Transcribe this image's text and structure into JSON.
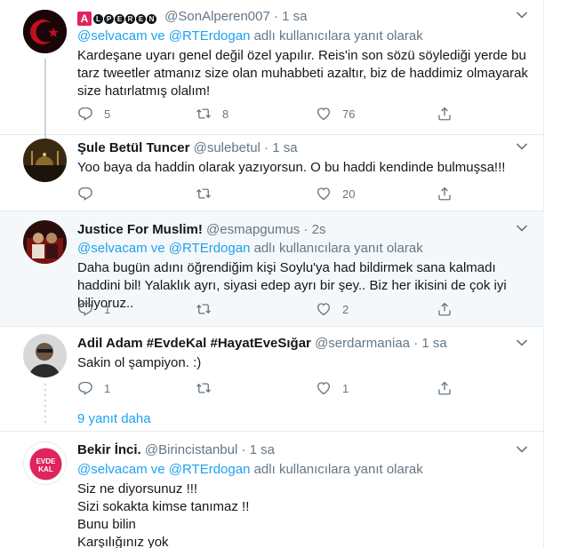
{
  "tweets": [
    {
      "name_badge": "A",
      "name_letters": [
        "L",
        "P",
        "E",
        "R",
        "E",
        "N"
      ],
      "handle": "@SonAlperen007",
      "dot": "·",
      "time": "1 sa",
      "reply_prefix": "@selvacam ve @RTErdogan",
      "reply_suffix": "adlı kullanıcılara yanıt olarak",
      "text": "Kardeşane uyarı genel değil özel yapılır. Reis'in son sözü söylediği yerde bu tarz tweetler atmanız size olan muhabbeti azaltır, biz de haddimiz olmayarak size hatırlatmış olalım!",
      "replies": "5",
      "retweets": "8",
      "likes": "76"
    },
    {
      "name": "Şule Betül Tuncer",
      "handle": "@sulebetul",
      "dot": "·",
      "time": "1 sa",
      "text": "Yoo baya da haddin olarak yazıyorsun. O bu haddi kendinde bulmuşsa!!!",
      "replies": "",
      "retweets": "",
      "likes": "20"
    },
    {
      "name": "Justice For Muslim!",
      "handle": "@esmapgumus",
      "dot": "·",
      "time": "2s",
      "reply_prefix": "@selvacam ve @RTErdogan",
      "reply_suffix": "adlı kullanıcılara yanıt olarak",
      "text": "Daha bugün adını öğrendiğim kişi Soylu'ya had bildirmek sana kalmadı haddini bil! Yalaklık ayrı, siyasi edep ayrı bir şey.. Biz her ikisini de çok iyi biliyoruz..",
      "replies": "1",
      "retweets": "",
      "likes": "2"
    },
    {
      "name": "Adil Adam #EvdeKal #HayatEveSığar",
      "handle": "@serdarmaniaa",
      "dot": "·",
      "time": "1 sa",
      "text": "Sakin ol şampiyon. :)",
      "replies": "1",
      "retweets": "",
      "likes": "1"
    },
    {
      "name": "Bekir İnci.",
      "handle": "@Birincistanbul",
      "dot": "·",
      "time": "1 sa",
      "reply_prefix": "@selvacam ve @RTErdogan",
      "reply_suffix": "adlı kullanıcılara yanıt olarak",
      "lines": [
        "Siz ne diyorsunuz !!!",
        "Sizi sokakta kimse tanımaz !!",
        "Bunu bilin",
        "Karşılığınız yok"
      ],
      "avatar_text": [
        "EVDE",
        "KAL"
      ]
    }
  ],
  "more_replies": "9 yanıt daha",
  "colors": {
    "accent": "#1da1f2",
    "muted": "#657786",
    "text": "#14171a",
    "divider": "#e6ecf0",
    "evde_kal_red": "#e0245e"
  },
  "icons": [
    "reply-icon",
    "retweet-icon",
    "like-icon",
    "share-icon",
    "caret-down-icon"
  ]
}
